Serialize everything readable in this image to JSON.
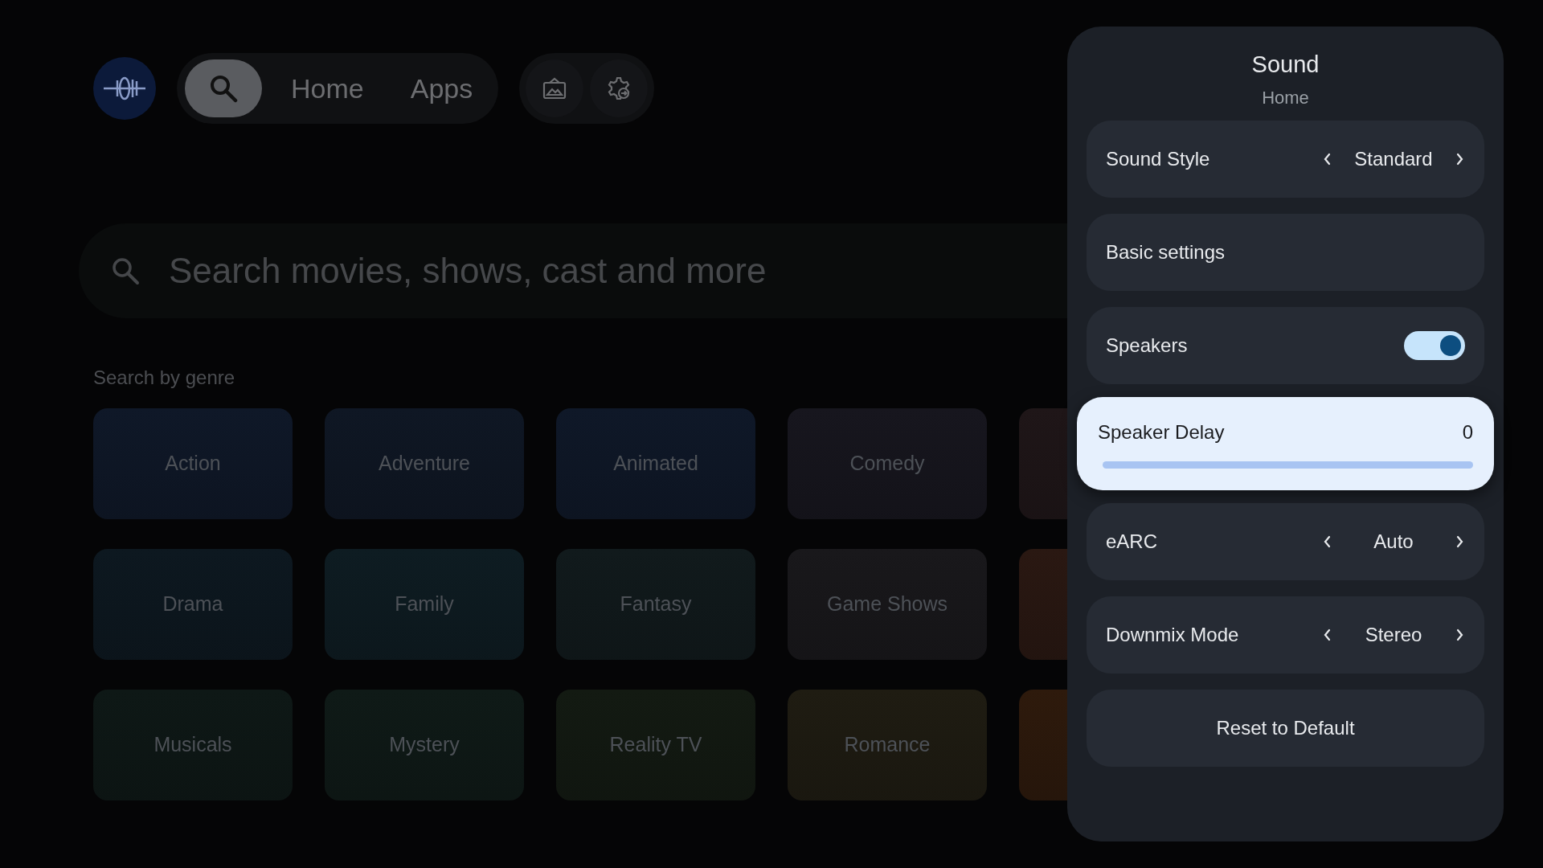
{
  "top_bar": {
    "tabs": [
      {
        "kind": "search",
        "selected": true
      },
      {
        "kind": "text",
        "label": "Home",
        "selected": false
      },
      {
        "kind": "text",
        "label": "Apps",
        "selected": false
      }
    ]
  },
  "search": {
    "placeholder": "Search movies, shows, cast and more"
  },
  "genres": {
    "heading": "Search by genre",
    "rows": [
      [
        {
          "label": "Action",
          "color": "#0f1828"
        },
        {
          "label": "Adventure",
          "color": "#0f1724"
        },
        {
          "label": "Animated",
          "color": "#0f1828"
        },
        {
          "label": "Comedy",
          "color": "#17161e"
        },
        {
          "color": "#1f1618"
        }
      ],
      [
        {
          "label": "Drama",
          "color": "#0d1820"
        },
        {
          "label": "Family",
          "color": "#0e1c22"
        },
        {
          "label": "Fantasy",
          "color": "#111a1c"
        },
        {
          "label": "Game Shows",
          "color": "#19181b"
        },
        {
          "color": "#2a1812"
        }
      ],
      [
        {
          "label": "Musicals",
          "color": "#0e1816"
        },
        {
          "label": "Mystery",
          "color": "#0f1a17"
        },
        {
          "label": "Reality TV",
          "color": "#131a12"
        },
        {
          "label": "Romance",
          "color": "#1f1c12"
        },
        {
          "color": "#2e1a0c"
        }
      ]
    ]
  },
  "panel": {
    "title": "Sound",
    "subtitle": "Home",
    "rows": [
      {
        "kind": "selector",
        "label": "Sound Style",
        "value": "Standard",
        "focused": false
      },
      {
        "kind": "link",
        "label": "Basic settings",
        "focused": false
      },
      {
        "kind": "toggle",
        "label": "Speakers",
        "on": true,
        "focused": false
      },
      {
        "kind": "slider",
        "label": "Speaker Delay",
        "value": "0",
        "level": 0,
        "focused": true
      },
      {
        "kind": "selector",
        "label": "eARC",
        "value": "Auto",
        "focused": false
      },
      {
        "kind": "selector",
        "label": "Downmix Mode",
        "value": "Stereo",
        "focused": false
      },
      {
        "kind": "button",
        "label": "Reset to Default",
        "focused": false
      }
    ]
  }
}
